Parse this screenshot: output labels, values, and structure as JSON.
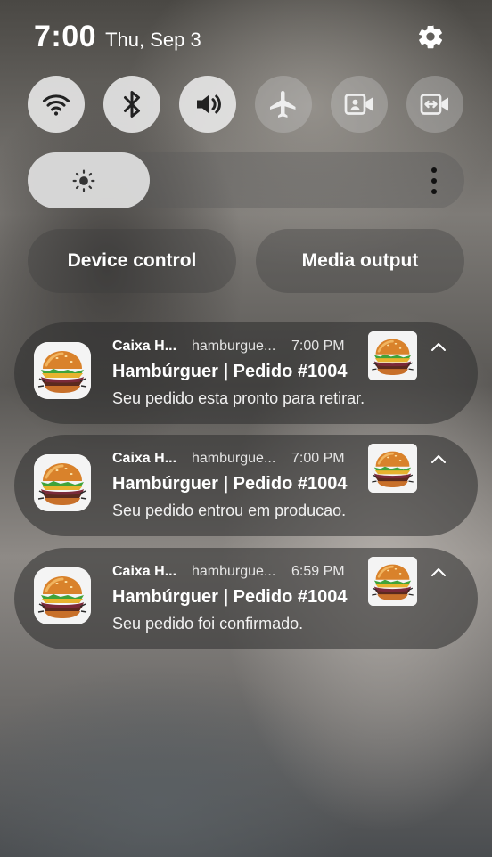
{
  "status": {
    "time": "7:00",
    "date": "Thu, Sep 3"
  },
  "quick_settings": [
    {
      "name": "Wi-Fi",
      "icon": "wifi-icon",
      "state": "on"
    },
    {
      "name": "Bluetooth",
      "icon": "bluetooth-icon",
      "state": "on"
    },
    {
      "name": "Sound",
      "icon": "volume-icon",
      "state": "on"
    },
    {
      "name": "Airplane mode",
      "icon": "airplane-icon",
      "state": "off"
    },
    {
      "name": "Screen recorder",
      "icon": "screen-recorder-icon",
      "state": "off"
    },
    {
      "name": "Smart View",
      "icon": "smart-view-icon",
      "state": "off"
    }
  ],
  "brightness": {
    "level": 0.28
  },
  "pills": {
    "device_control": "Device control",
    "media_output": "Media output"
  },
  "notifications": [
    {
      "app": "Caixa H...",
      "channel": "hamburgue...",
      "time": "7:00 PM",
      "title": "Hambúrguer | Pedido #1004",
      "body": "Seu pedido esta pronto para retirar."
    },
    {
      "app": "Caixa H...",
      "channel": "hamburgue...",
      "time": "7:00 PM",
      "title": "Hambúrguer | Pedido #1004",
      "body": "Seu pedido entrou em producao."
    },
    {
      "app": "Caixa H...",
      "channel": "hamburgue...",
      "time": "6:59 PM",
      "title": "Hambúrguer | Pedido #1004",
      "body": "Seu pedido foi confirmado."
    }
  ]
}
